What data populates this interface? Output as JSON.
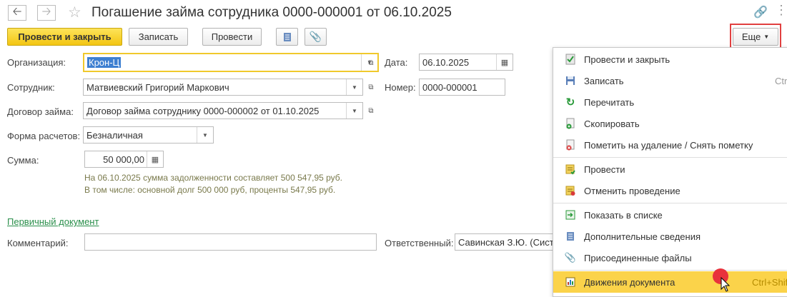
{
  "header": {
    "title": "Погашение займа сотрудника 0000-000001 от 06.10.2025",
    "back_icon": "arrow-left-icon",
    "forward_icon": "arrow-right-icon"
  },
  "toolbar": {
    "post_close": "Провести и закрыть",
    "save": "Записать",
    "post": "Провести",
    "more": "Еще"
  },
  "form": {
    "org_label": "Организация:",
    "org_value": "Крон-Ц",
    "date_label": "Дата:",
    "date_value": "06.10.2025",
    "employee_label": "Сотрудник:",
    "employee_value": "Матвиевский Григорий Маркович",
    "number_label": "Номер:",
    "number_value": "0000-000001",
    "contract_label": "Договор займа:",
    "contract_value": "Договор займа сотруднику 0000-000002 от 01.10.2025",
    "payment_label": "Форма расчетов:",
    "payment_value": "Безналичная",
    "sum_label": "Сумма:",
    "sum_value": "50 000,00",
    "hint_line1": "На 06.10.2025 сумма задолженности составляет 500 547,95 руб.",
    "hint_line2": "В том числе: основной долг 500 000 руб, проценты 547,95 руб.",
    "primary_doc_link": "Первичный документ",
    "comment_label": "Комментарий:",
    "responsible_label": "Ответственный:",
    "responsible_value": "Савинская З.Ю. (Сист"
  },
  "menu": {
    "items": [
      {
        "label": "Провести и закрыть",
        "shortcut": ""
      },
      {
        "label": "Записать",
        "shortcut": "Ctr"
      },
      {
        "label": "Перечитать",
        "shortcut": ""
      },
      {
        "label": "Скопировать",
        "shortcut": ""
      },
      {
        "label": "Пометить на удаление / Снять пометку",
        "shortcut": ""
      },
      {
        "label": "Провести",
        "shortcut": ""
      },
      {
        "label": "Отменить проведение",
        "shortcut": ""
      },
      {
        "label": "Показать в списке",
        "shortcut": ""
      },
      {
        "label": "Дополнительные сведения",
        "shortcut": ""
      },
      {
        "label": "Присоединенные файлы",
        "shortcut": ""
      },
      {
        "label": "Движения документа",
        "shortcut": "Ctrl+Shift"
      }
    ]
  },
  "colors": {
    "accent_yellow": "#f3c512",
    "highlight_frame": "#e14040",
    "link_green": "#2a8f4b",
    "hint_text": "#7a7a4c"
  }
}
